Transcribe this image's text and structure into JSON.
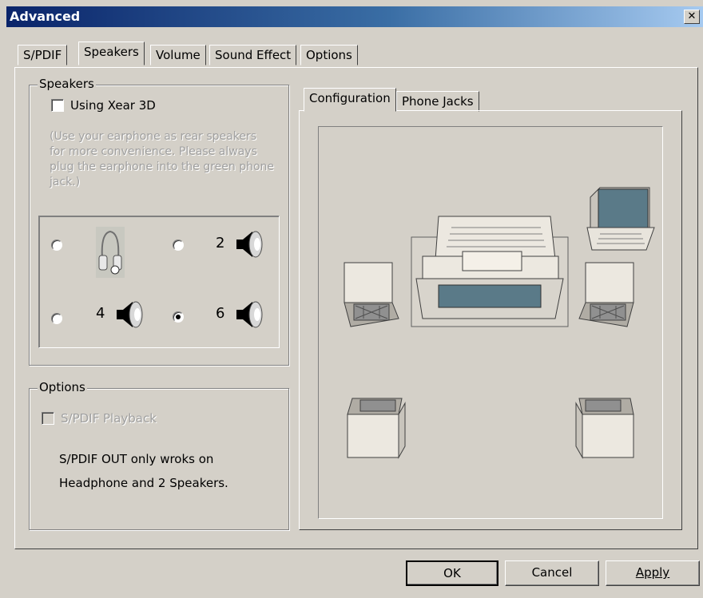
{
  "window": {
    "title": "Advanced"
  },
  "tabs": [
    "S/PDIF",
    "Speakers",
    "Volume",
    "Sound Effect",
    "Options"
  ],
  "active_tab": "Speakers",
  "speakers_group": {
    "label": "Speakers",
    "xear_label": "Using Xear 3D",
    "xear_checked": false,
    "hint_lines": [
      "(Use your earphone as rear speakers",
      "for more convenience. Please always",
      "plug the earphone into the green phone",
      "jack.)"
    ],
    "modes": [
      {
        "id": "headphone",
        "label": "",
        "selected": false
      },
      {
        "id": "2",
        "label": "2",
        "selected": false
      },
      {
        "id": "4",
        "label": "4",
        "selected": false
      },
      {
        "id": "6",
        "label": "6",
        "selected": true
      }
    ]
  },
  "options_group": {
    "label": "Options",
    "spdif_label": "S/PDIF Playback",
    "note_line1": "S/PDIF OUT only wroks on",
    "note_line2": "Headphone and 2 Speakers."
  },
  "config_tabs": [
    "Configuration",
    "Phone Jacks"
  ],
  "active_config_tab": "Configuration",
  "buttons": {
    "ok": "OK",
    "cancel": "Cancel",
    "apply": "Apply"
  },
  "colors": {
    "title_start": "#0a246a",
    "title_end": "#a6caf0",
    "face": "#d4d0c8",
    "screen": "#5a7a88"
  }
}
